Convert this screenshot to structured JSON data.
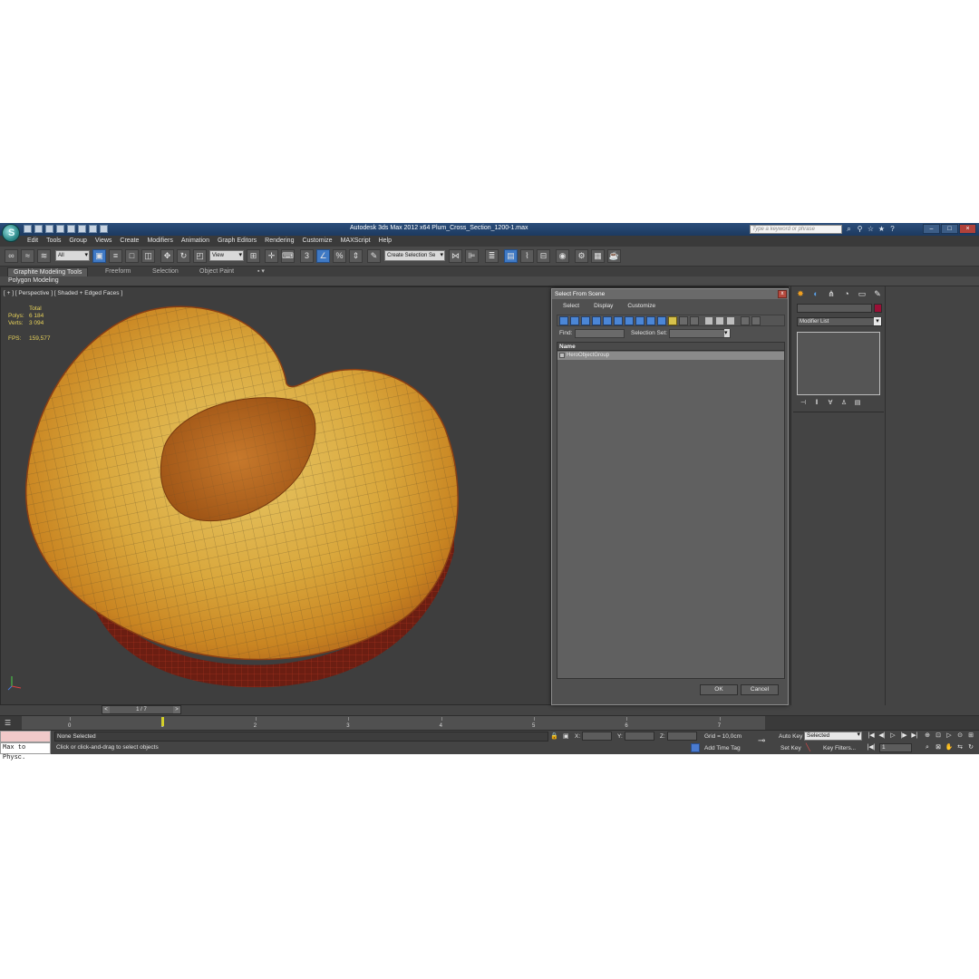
{
  "title_bar": {
    "title": "Autodesk 3ds Max  2012 x64     Plum_Cross_Section_1200-1.max",
    "search_placeholder": "Type a keyword or phrase"
  },
  "menu": [
    "Edit",
    "Tools",
    "Group",
    "Views",
    "Create",
    "Modifiers",
    "Animation",
    "Graph Editors",
    "Rendering",
    "Customize",
    "MAXScript",
    "Help"
  ],
  "toolbar": {
    "filter_value": "All",
    "view_value": "View",
    "selection_set_value": "Create Selection Se"
  },
  "ribbon": {
    "tabs": [
      "Graphite Modeling Tools",
      "Freeform",
      "Selection",
      "Object Paint"
    ],
    "panel_label": "Polygon Modeling"
  },
  "viewport": {
    "label": "[ + ] [ Perspective ] [ Shaded + Edged Faces ]",
    "stats": {
      "total_label": "Total",
      "polys_label": "Polys:",
      "polys_value": "6 184",
      "verts_label": "Verts:",
      "verts_value": "3 094",
      "fps_label": "FPS:",
      "fps_value": "159,577"
    }
  },
  "dialog": {
    "title": "Select From Scene",
    "close_glyph": "x",
    "menu": [
      "Select",
      "Display",
      "Customize"
    ],
    "find_label": "Find:",
    "selection_set_label": "Selection Set:",
    "column_name": "Name",
    "items": [
      "HeroObjectGroup"
    ],
    "ok_label": "OK",
    "cancel_label": "Cancel"
  },
  "command_panel": {
    "modifier_list_label": "Modifier List"
  },
  "timeline": {
    "frame_display": "1 / 7",
    "ticks": [
      "0",
      "1",
      "2",
      "3",
      "4",
      "5",
      "6",
      "7"
    ]
  },
  "status": {
    "maxscript_text": "Max to Physc.",
    "selection_status": "None Selected",
    "prompt": "Click or click-and-drag to select objects",
    "x_label": "X:",
    "y_label": "Y:",
    "z_label": "Z:",
    "grid": "Grid = 10,0cm",
    "add_time_tag": "Add Time Tag",
    "auto_key": "Auto Key",
    "set_key": "Set Key",
    "key_mode_value": "Selected",
    "key_filters": "Key Filters...",
    "current_frame": "1"
  }
}
